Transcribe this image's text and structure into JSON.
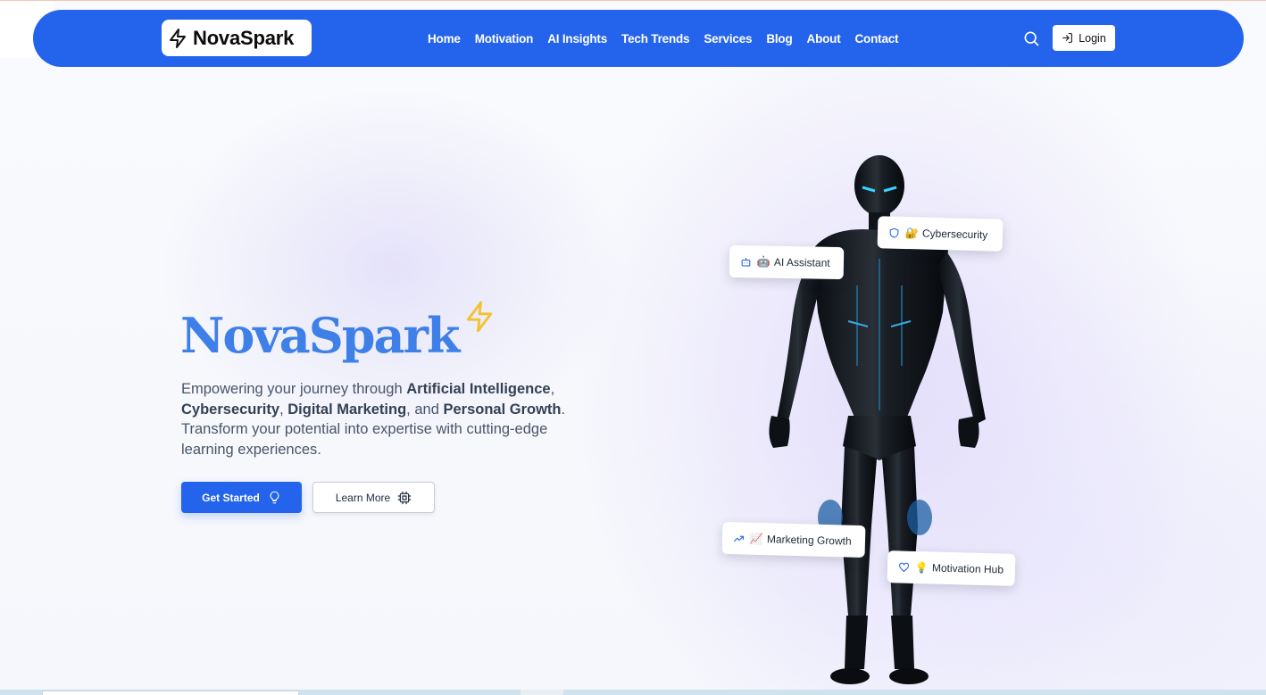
{
  "brand": {
    "name": "NovaSpark",
    "logo_icon": "lightning-icon"
  },
  "nav": {
    "links": [
      "Home",
      "Motivation",
      "AI Insights",
      "Tech Trends",
      "Services",
      "Blog",
      "About",
      "Contact"
    ],
    "search_icon": "search-icon",
    "login_label": "Login",
    "login_icon": "login-icon"
  },
  "hero": {
    "title": "NovaSpark",
    "title_icon": "lightning-icon",
    "description": {
      "t1": "Empowering your journey through ",
      "b1": "Artificial Intelligence",
      "t2": ", ",
      "b2": "Cybersecurity",
      "t3": ", ",
      "b3": "Digital Marketing",
      "t4": ", and ",
      "b4": "Personal Growth",
      "t5": ". Transform your potential into expertise with cutting-edge learning experiences."
    },
    "primary_button": {
      "label": "Get Started",
      "icon": "lightbulb-icon"
    },
    "secondary_button": {
      "label": "Learn More",
      "icon": "cpu-icon"
    }
  },
  "tags": [
    {
      "icon": "bot-icon",
      "emoji": "🤖",
      "label": "AI Assistant"
    },
    {
      "icon": "shield-icon",
      "emoji": "🔐",
      "label": "Cybersecurity"
    },
    {
      "icon": "trending-up-icon",
      "emoji": "📈",
      "label": "Marketing Growth"
    },
    {
      "icon": "heart-icon",
      "emoji": "💡",
      "label": "Motivation Hub"
    }
  ],
  "colors": {
    "primary": "#2463eb",
    "title": "#3e7fe8",
    "spark": "#f2c230",
    "text": "#475569"
  }
}
